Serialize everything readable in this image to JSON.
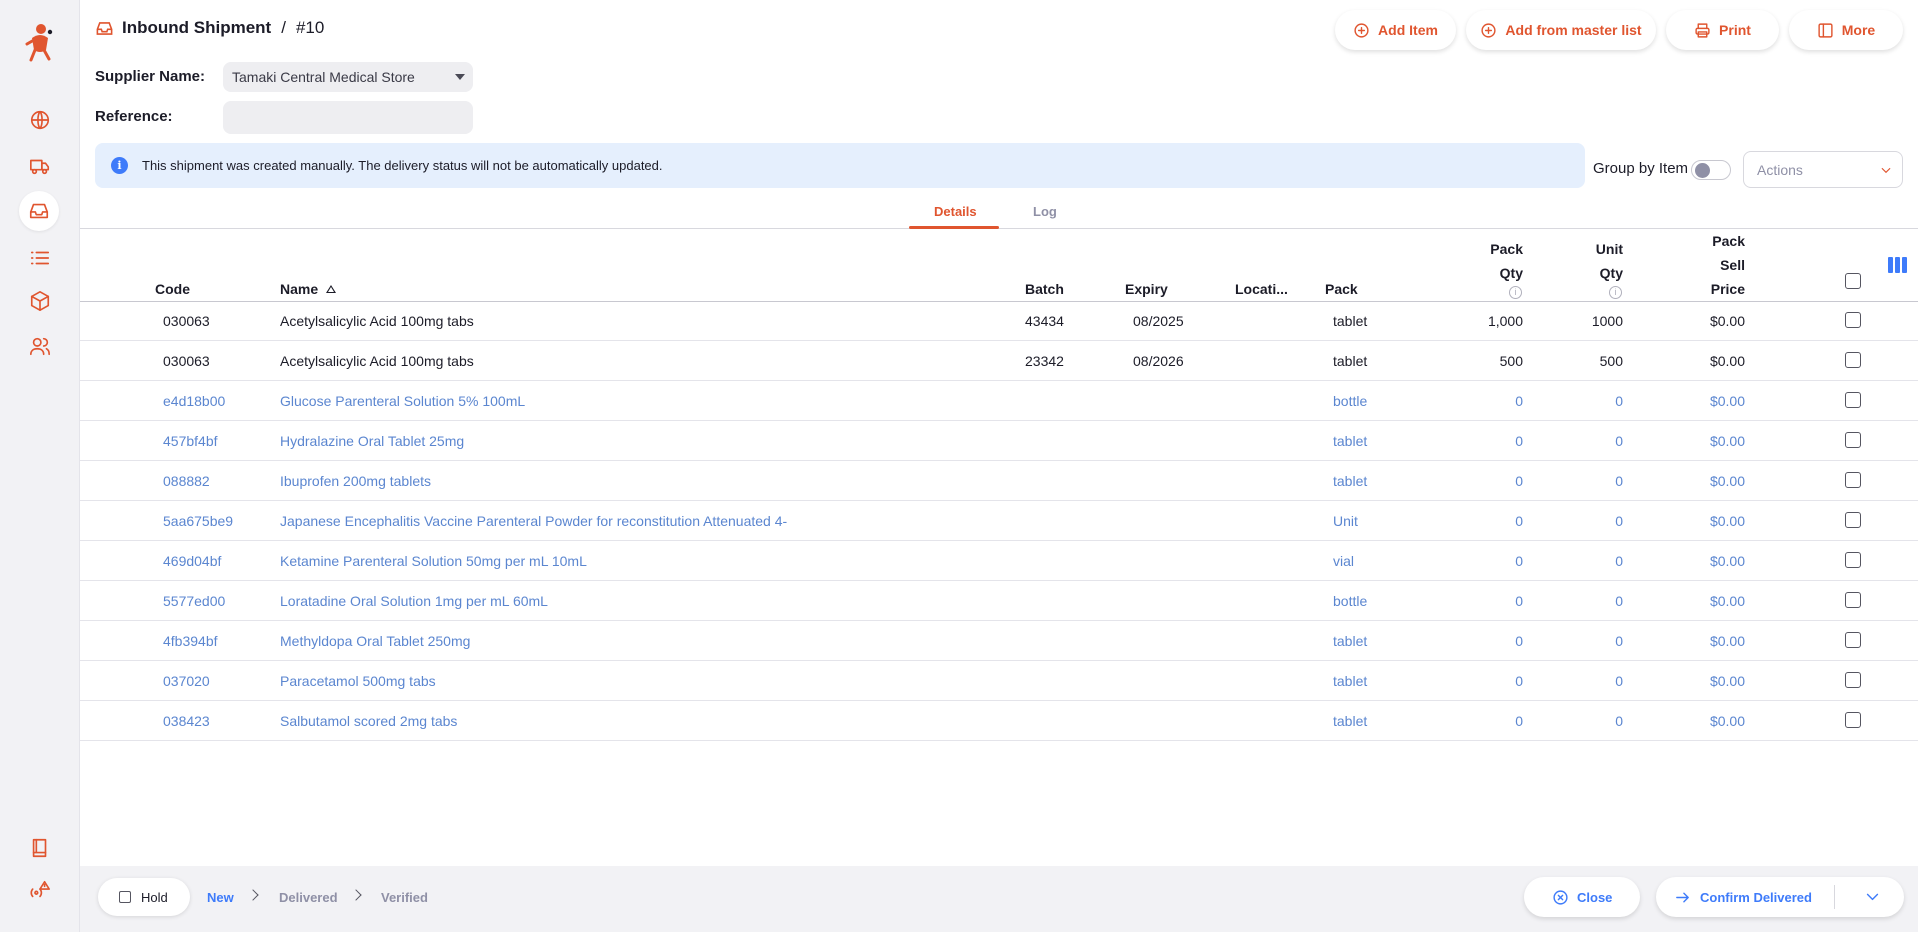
{
  "header": {
    "title": "Inbound Shipment",
    "separator": "/",
    "number": "#10",
    "buttons": {
      "add_item": "Add Item",
      "add_from_master": "Add from master list",
      "print": "Print",
      "more": "More"
    }
  },
  "form": {
    "supplier_label": "Supplier Name:",
    "supplier_value": "Tamaki Central Medical Store",
    "reference_label": "Reference:",
    "reference_value": ""
  },
  "banner": {
    "text": "This shipment was created manually. The delivery status will not be automatically updated."
  },
  "controls": {
    "group_by_label": "Group by Item",
    "group_by_on": false,
    "actions_placeholder": "Actions"
  },
  "tabs": [
    {
      "label": "Details",
      "active": true
    },
    {
      "label": "Log",
      "active": false
    }
  ],
  "table": {
    "headers": {
      "code": "Code",
      "name": "Name",
      "batch": "Batch",
      "expiry": "Expiry",
      "location": "Locati...",
      "pack": "Pack",
      "pack_qty_1": "Pack",
      "pack_qty_2": "Qty",
      "unit_qty_1": "Unit",
      "unit_qty_2": "Qty",
      "price_1": "Pack",
      "price_2": "Sell",
      "price_3": "Price"
    },
    "info_glyph": "i",
    "rows": [
      {
        "code": "030063",
        "name": "Acetylsalicylic Acid 100mg tabs",
        "batch": "43434",
        "expiry": "08/2025",
        "location": "",
        "pack": "tablet",
        "pack_qty": "1,000",
        "unit_qty": "1000",
        "price": "$0.00",
        "placeholder": false
      },
      {
        "code": "030063",
        "name": "Acetylsalicylic Acid 100mg tabs",
        "batch": "23342",
        "expiry": "08/2026",
        "location": "",
        "pack": "tablet",
        "pack_qty": "500",
        "unit_qty": "500",
        "price": "$0.00",
        "placeholder": false
      },
      {
        "code": "e4d18b00",
        "name": "Glucose Parenteral Solution 5% 100mL",
        "batch": "",
        "expiry": "",
        "location": "",
        "pack": "bottle",
        "pack_qty": "0",
        "unit_qty": "0",
        "price": "$0.00",
        "placeholder": true
      },
      {
        "code": "457bf4bf",
        "name": "Hydralazine Oral Tablet 25mg",
        "batch": "",
        "expiry": "",
        "location": "",
        "pack": "tablet",
        "pack_qty": "0",
        "unit_qty": "0",
        "price": "$0.00",
        "placeholder": true
      },
      {
        "code": "088882",
        "name": "Ibuprofen 200mg tablets",
        "batch": "",
        "expiry": "",
        "location": "",
        "pack": "tablet",
        "pack_qty": "0",
        "unit_qty": "0",
        "price": "$0.00",
        "placeholder": true
      },
      {
        "code": "5aa675be9",
        "name": "Japanese Encephalitis Vaccine Parenteral Powder for reconstitution Attenuated 4-",
        "batch": "",
        "expiry": "",
        "location": "",
        "pack": "Unit",
        "pack_qty": "0",
        "unit_qty": "0",
        "price": "$0.00",
        "placeholder": true
      },
      {
        "code": "469d04bf",
        "name": "Ketamine Parenteral Solution 50mg per mL 10mL",
        "batch": "",
        "expiry": "",
        "location": "",
        "pack": "vial",
        "pack_qty": "0",
        "unit_qty": "0",
        "price": "$0.00",
        "placeholder": true
      },
      {
        "code": "5577ed00",
        "name": "Loratadine Oral Solution 1mg per mL 60mL",
        "batch": "",
        "expiry": "",
        "location": "",
        "pack": "bottle",
        "pack_qty": "0",
        "unit_qty": "0",
        "price": "$0.00",
        "placeholder": true
      },
      {
        "code": "4fb394bf",
        "name": "Methyldopa Oral Tablet 250mg",
        "batch": "",
        "expiry": "",
        "location": "",
        "pack": "tablet",
        "pack_qty": "0",
        "unit_qty": "0",
        "price": "$0.00",
        "placeholder": true
      },
      {
        "code": "037020",
        "name": "Paracetamol 500mg tabs",
        "batch": "",
        "expiry": "",
        "location": "",
        "pack": "tablet",
        "pack_qty": "0",
        "unit_qty": "0",
        "price": "$0.00",
        "placeholder": true
      },
      {
        "code": "038423",
        "name": "Salbutamol scored 2mg tabs",
        "batch": "",
        "expiry": "",
        "location": "",
        "pack": "tablet",
        "pack_qty": "0",
        "unit_qty": "0",
        "price": "$0.00",
        "placeholder": true
      }
    ]
  },
  "footer": {
    "hold_label": "Hold",
    "steps": [
      "New",
      "Delivered",
      "Verified"
    ],
    "close_label": "Close",
    "confirm_label": "Confirm Delivered"
  },
  "colors": {
    "brand": "#e0552f",
    "link": "#3e7bfa",
    "placeholder_row": "#5b86d0",
    "banner_bg": "#e5effd"
  },
  "sidebar_icons": [
    "dashboard-globe-icon",
    "distribution-truck-icon",
    "replenishment-inbox-icon",
    "catalogue-list-icon",
    "inventory-box-icon",
    "patients-users-icon",
    "docs-book-icon",
    "sync-alert-icon"
  ]
}
